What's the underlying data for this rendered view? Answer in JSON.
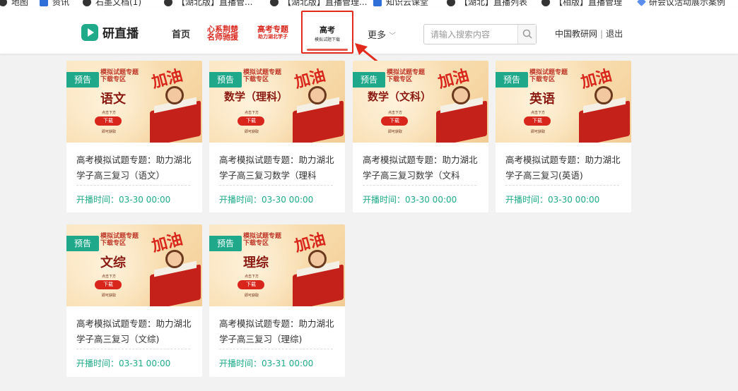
{
  "bookmarks": [
    {
      "label": "地图",
      "icon": "dark-circle-icon"
    },
    {
      "label": "资讯",
      "icon": "blue-square-icon"
    },
    {
      "label": "石墨文档(1)",
      "icon": "dark-circle-icon"
    },
    {
      "label": "【湖北版】直播管...",
      "icon": "dark-circle-icon"
    },
    {
      "label": "【湖北版】直播管理...",
      "icon": "dark-circle-icon"
    },
    {
      "label": "知识云课堂",
      "icon": "blue-drop-icon"
    },
    {
      "label": "【湖北】直播列表",
      "icon": "dark-circle-icon"
    },
    {
      "label": "【相版】直播管理",
      "icon": "dark-circle-icon"
    },
    {
      "label": "研会议活动展示案例",
      "icon": "diamond-icon"
    }
  ],
  "header": {
    "logo_text": "研直播",
    "nav": {
      "home": "首页",
      "promo1_line1": "心系荆楚",
      "promo1_line2": "名师驰援",
      "promo2_line1": "高考专题",
      "promo2_line2": "助力湖北学子",
      "gaokao_line1": "高考",
      "gaokao_line2": "模拟试题下载",
      "more": "更多"
    },
    "search_placeholder": "请输入搜索内容",
    "org_link": "中国教研网",
    "separator": "|",
    "logout": "退出"
  },
  "badge_label": "预告",
  "thumb_common": {
    "top_title_line1": "模拟试题专题",
    "top_title_line2": "下载专区",
    "hint_top": "点击下方",
    "download": "下载",
    "hint_bottom": "即可获取",
    "jiayou": "加油"
  },
  "cards": [
    {
      "subject": "语文",
      "title": "高考模拟试题专题：助力湖北学子高三复习（语文）",
      "time": "开播时间：03-30 00:00"
    },
    {
      "subject": "数学（理科）",
      "title": "高考模拟试题专题：助力湖北学子高三复习数学（理科",
      "time": "开播时间：03-30 00:00"
    },
    {
      "subject": "数学（文科）",
      "title": "高考模拟试题专题：助力湖北学子高三复习数学（文科",
      "time": "开播时间：03-30 00:00"
    },
    {
      "subject": "英语",
      "title": "高考模拟试题专题：助力湖北学子高三复习(英语)",
      "time": "开播时间：03-30 00:00"
    },
    {
      "subject": "文综",
      "title": "高考模拟试题专题：助力湖北学子高三复习（文综)",
      "time": "开播时间：03-31 00:00"
    },
    {
      "subject": "理综",
      "title": "高考模拟试题专题：助力湖北学子高三复习（理综)",
      "time": "开播时间：03-31 00:00"
    }
  ],
  "colors": {
    "accent": "#1fab89",
    "highlight": "#e22a1d"
  }
}
